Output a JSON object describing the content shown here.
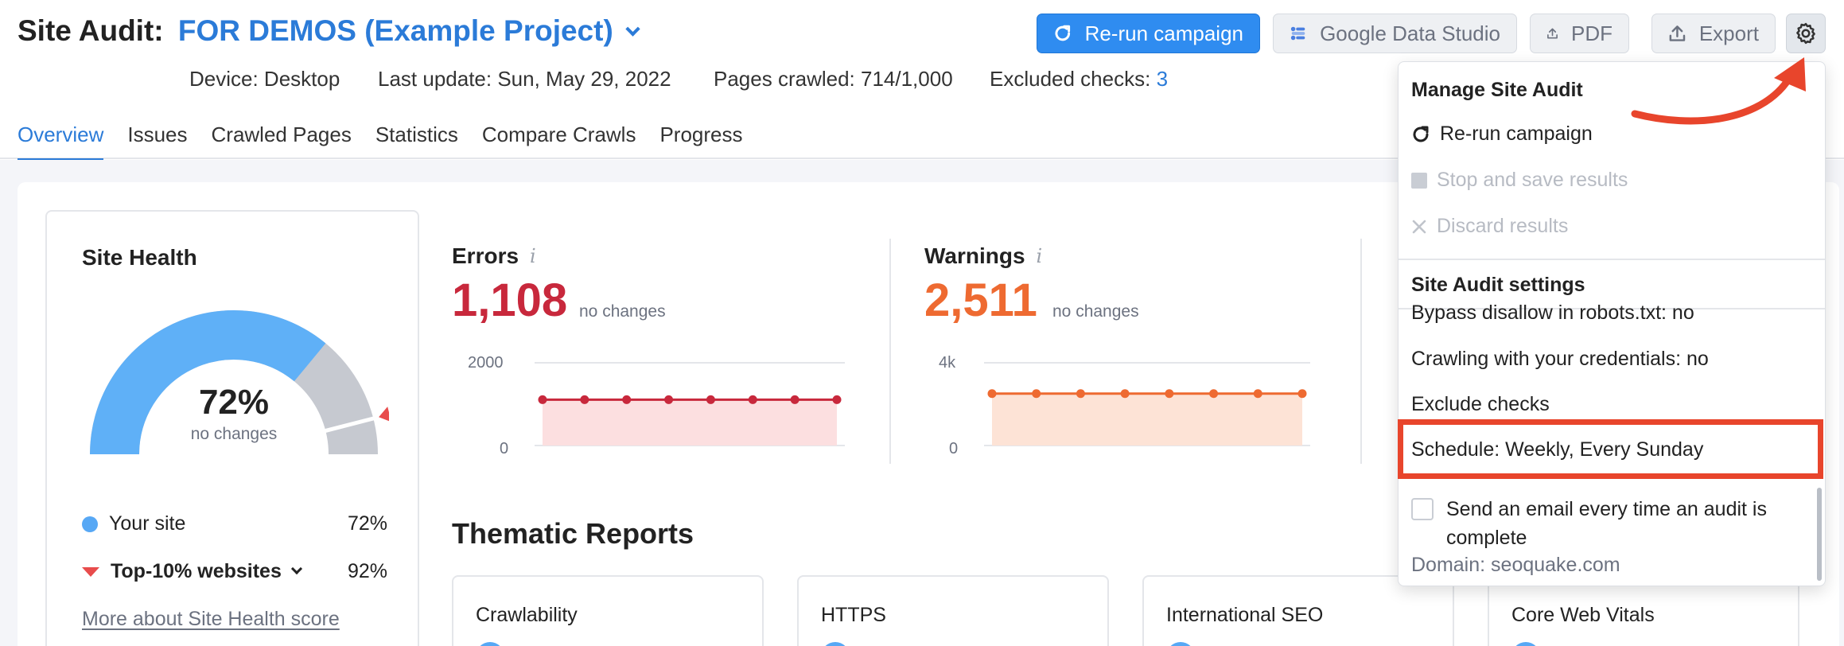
{
  "header": {
    "title_prefix": "Site Audit:",
    "project_name": "FOR DEMOS (Example Project)",
    "buttons": {
      "rerun": "Re-run campaign",
      "gds": "Google Data Studio",
      "pdf": "PDF",
      "export": "Export"
    },
    "meta": {
      "device": "Device: Desktop",
      "last_update": "Last update: Sun, May 29, 2022",
      "pages_crawled": "Pages crawled: 714/1,000",
      "excluded_label": "Excluded checks:",
      "excluded_count": "3"
    },
    "tabs": [
      "Overview",
      "Issues",
      "Crawled Pages",
      "Statistics",
      "Compare Crawls",
      "Progress"
    ],
    "active_tab": "Overview"
  },
  "site_health": {
    "title": "Site Health",
    "percent": "72%",
    "note": "no changes",
    "score_fraction": 0.72,
    "top10_fraction": 0.92,
    "legend": [
      {
        "label": "Your site",
        "value": "72%"
      },
      {
        "label": "Top-10% websites",
        "value": "92%"
      }
    ],
    "link": "More about Site Health score"
  },
  "errors": {
    "title": "Errors",
    "info": "i",
    "value": "1,108",
    "note": "no changes",
    "color": "#c8283c"
  },
  "warnings": {
    "title": "Warnings",
    "info": "i",
    "value": "2,511",
    "note": "no changes",
    "color": "#ee6a31"
  },
  "chart_data": [
    {
      "type": "area",
      "title": "Errors",
      "yticks": [
        "2000",
        "0"
      ],
      "ylim": [
        0,
        2000
      ],
      "x": [
        0,
        1,
        2,
        3,
        4,
        5,
        6,
        7
      ],
      "values": [
        1108,
        1108,
        1108,
        1108,
        1108,
        1108,
        1108,
        1108
      ],
      "color": "#c8283c",
      "fill": "#fcdfe0"
    },
    {
      "type": "area",
      "title": "Warnings",
      "yticks": [
        "4k",
        "0"
      ],
      "ylim": [
        0,
        4000
      ],
      "x": [
        0,
        1,
        2,
        3,
        4,
        5,
        6,
        7
      ],
      "values": [
        2511,
        2511,
        2511,
        2511,
        2511,
        2511,
        2511,
        2511
      ],
      "color": "#ee6a31",
      "fill": "#fde3d6"
    }
  ],
  "thematic": {
    "title": "Thematic Reports",
    "cards": [
      "Crawlability",
      "HTTPS",
      "International SEO",
      "Core Web Vitals"
    ]
  },
  "dropdown": {
    "manage_heading": "Manage Site Audit",
    "rerun": "Re-run campaign",
    "stop": "Stop and save results",
    "discard": "Discard results",
    "settings_heading": "Site Audit settings",
    "bypass": "Bypass disallow in robots.txt: no",
    "credentials": "Crawling with your credentials: no",
    "exclude": "Exclude checks",
    "schedule": "Schedule: Weekly, Every Sunday",
    "email": "Send an email every time an audit is complete",
    "domain": "Domain: seoquake.com"
  },
  "colors": {
    "accent": "#2b7bd8",
    "primary_button": "#2f8cf0",
    "annotation": "#e8452c"
  }
}
